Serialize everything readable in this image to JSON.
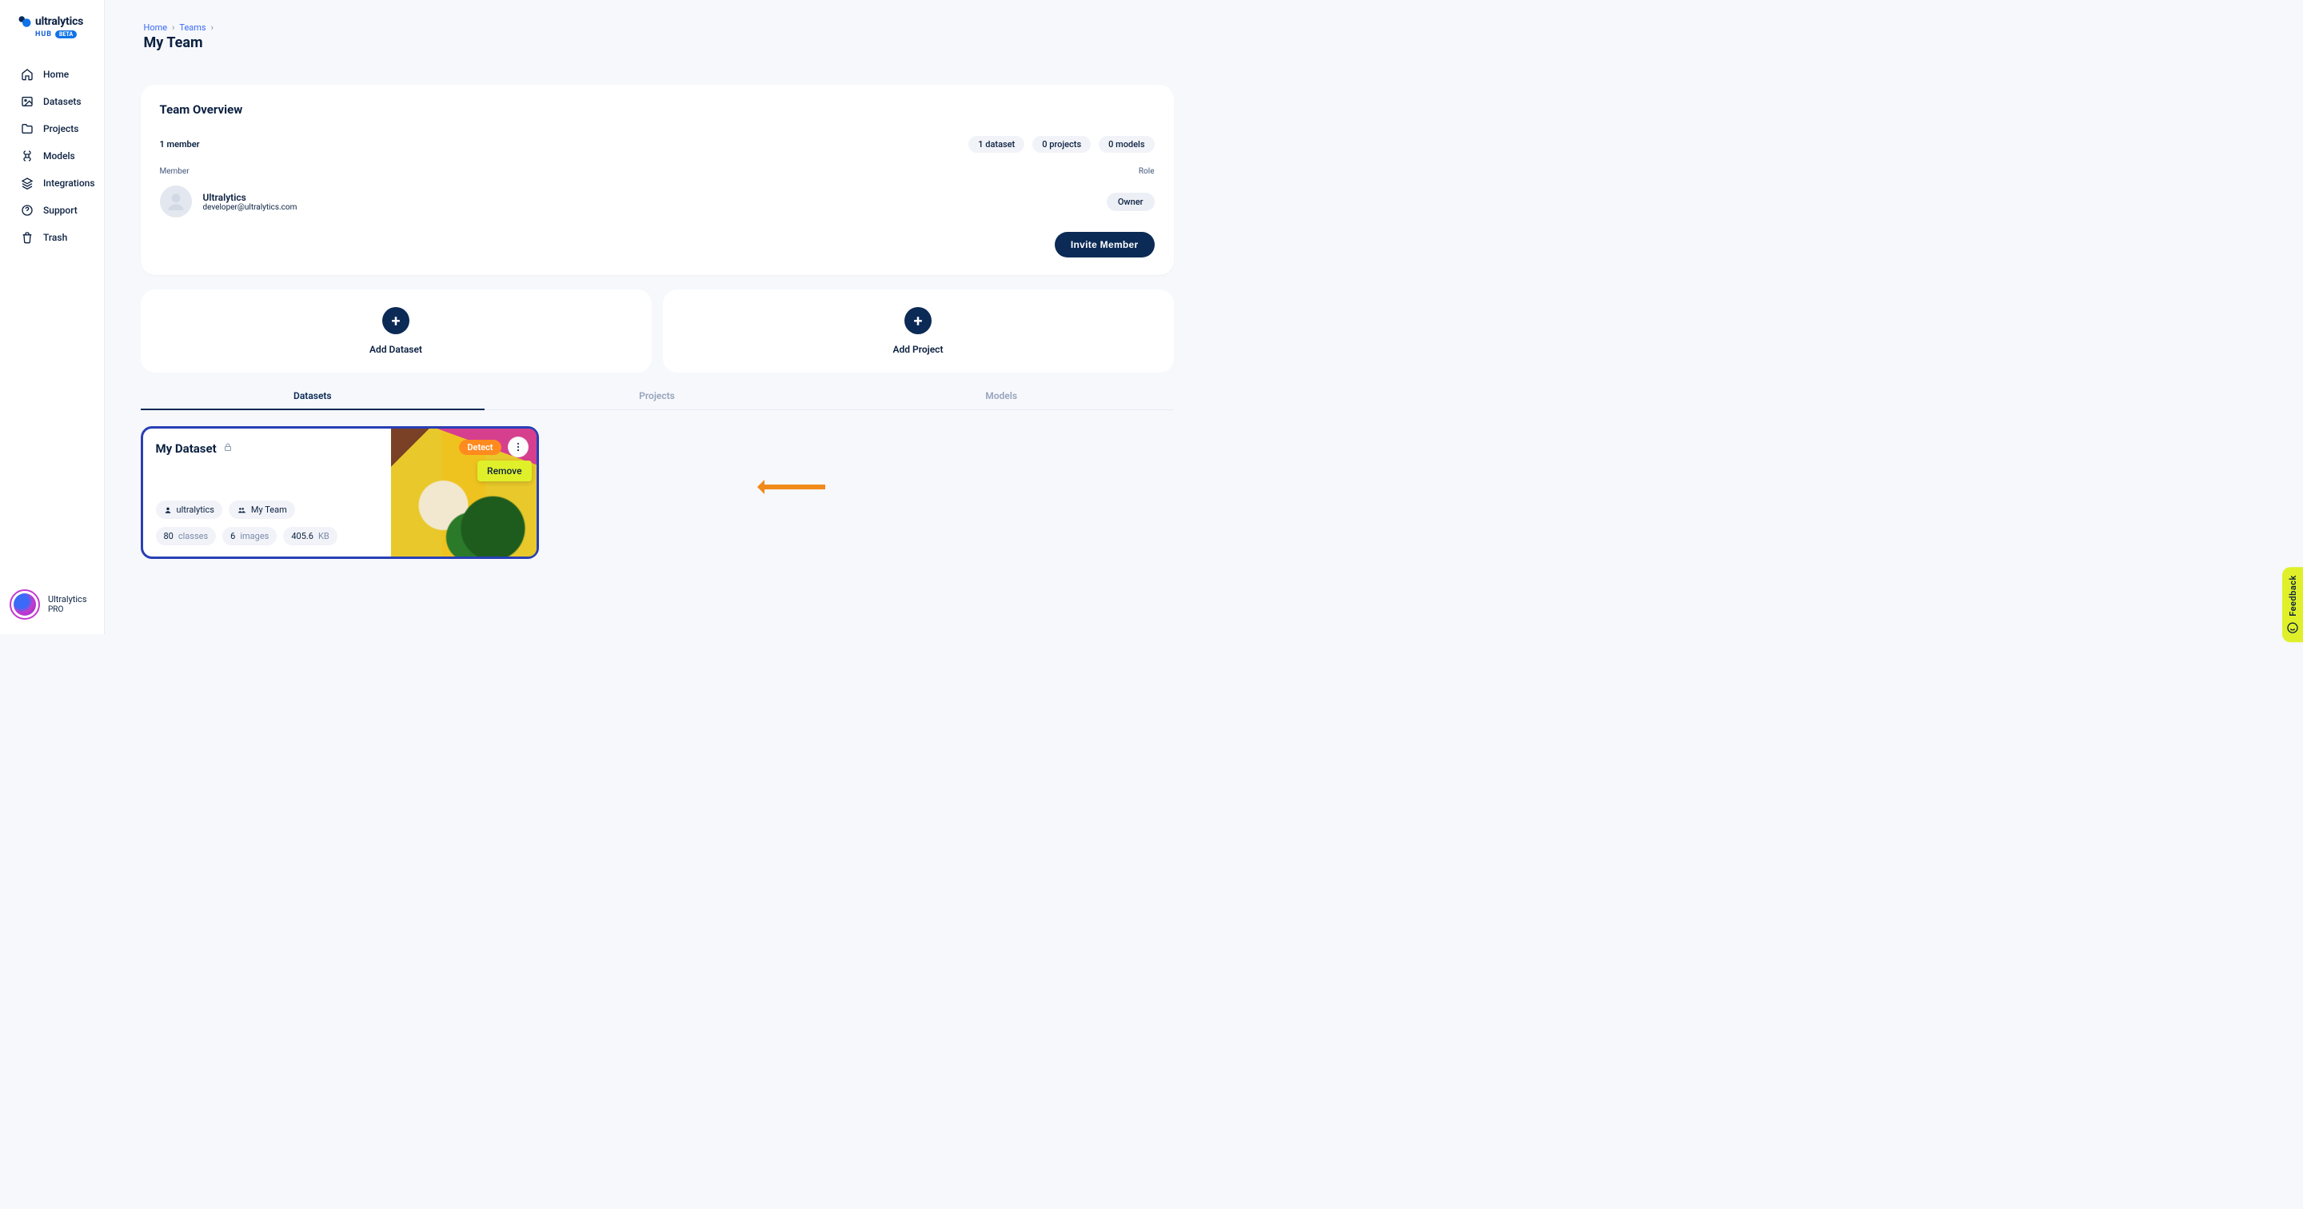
{
  "brand": {
    "name": "ultralytics",
    "sub": "HUB",
    "badge": "BETA"
  },
  "sidebar": {
    "items": [
      {
        "label": "Home"
      },
      {
        "label": "Datasets"
      },
      {
        "label": "Projects"
      },
      {
        "label": "Models"
      },
      {
        "label": "Integrations"
      },
      {
        "label": "Support"
      },
      {
        "label": "Trash"
      }
    ],
    "user": {
      "name": "Ultralytics",
      "plan": "PRO"
    }
  },
  "breadcrumb": {
    "home": "Home",
    "teams": "Teams"
  },
  "page_title": "My Team",
  "overview": {
    "heading": "Team Overview",
    "member_count": "1 member",
    "stats": {
      "datasets": "1 dataset",
      "projects": "0 projects",
      "models": "0 models"
    },
    "col_member": "Member",
    "col_role": "Role",
    "member": {
      "name": "Ultralytics",
      "email": "developer@ultralytics.com",
      "role": "Owner"
    },
    "invite_label": "Invite Member"
  },
  "add": {
    "dataset": "Add Dataset",
    "project": "Add Project"
  },
  "tabs": {
    "datasets": "Datasets",
    "projects": "Projects",
    "models": "Models"
  },
  "dataset_card": {
    "title": "My Dataset",
    "owner": "ultralytics",
    "team": "My Team",
    "classes_num": "80",
    "classes_label": "classes",
    "images_num": "6",
    "images_label": "images",
    "size_num": "405.6",
    "size_unit": "KB",
    "detect_badge": "Detect",
    "menu_remove": "Remove"
  },
  "feedback": {
    "label": "Feedback"
  }
}
